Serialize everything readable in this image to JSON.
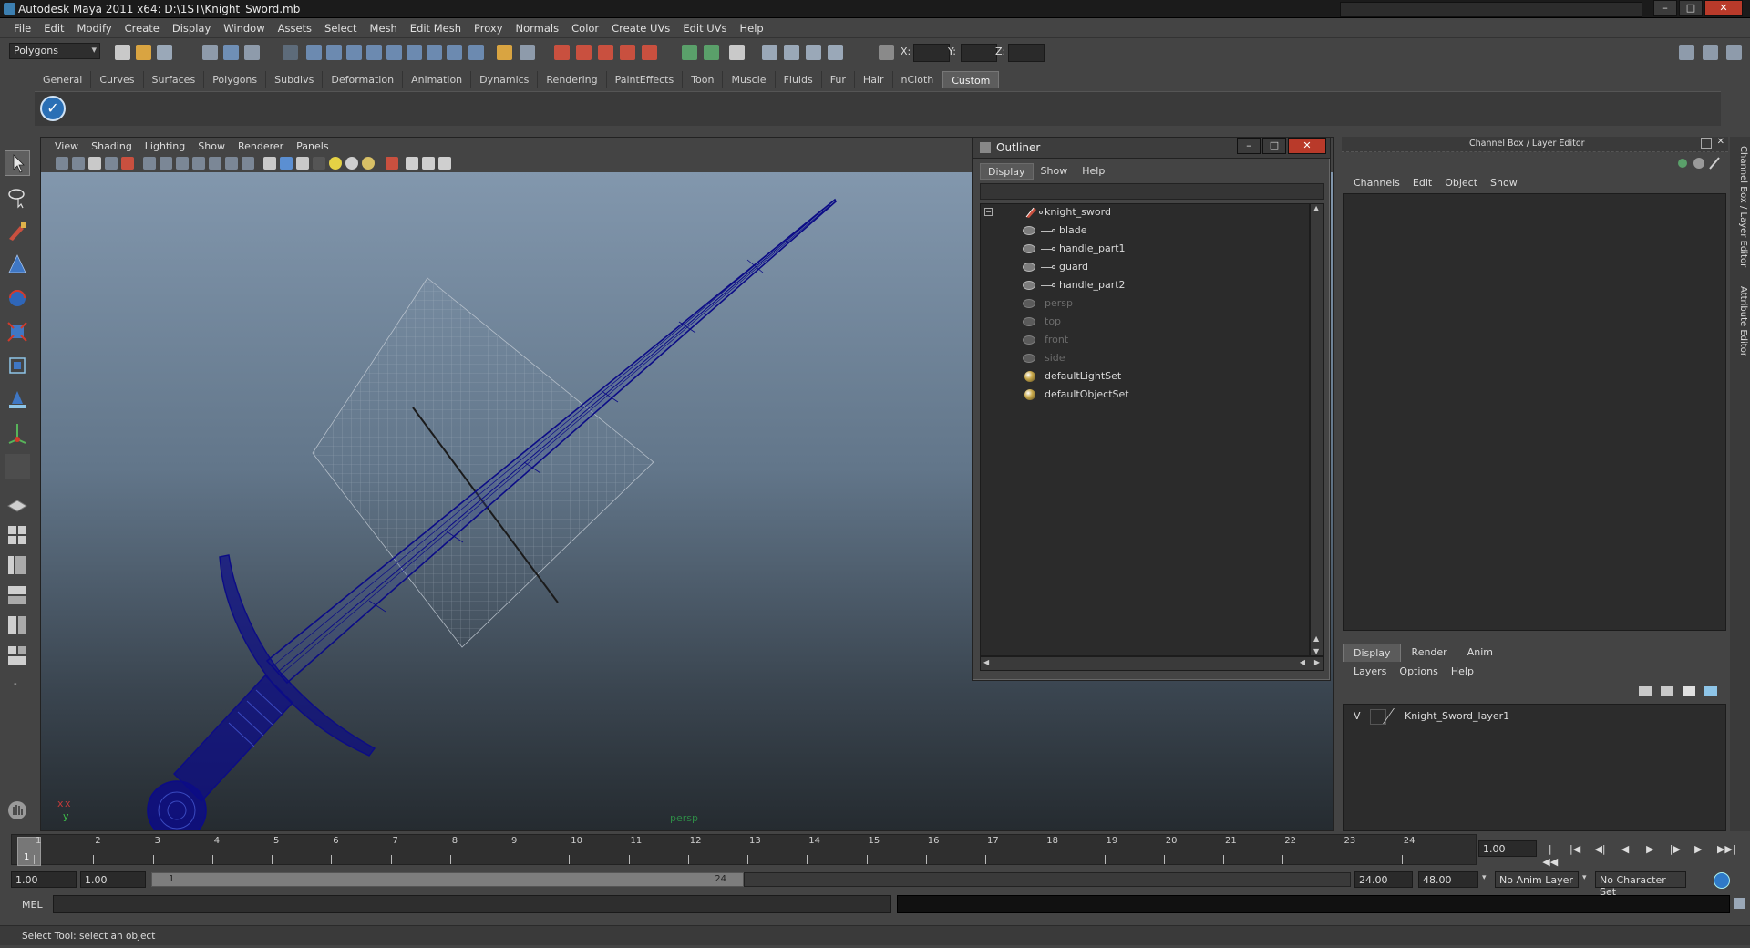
{
  "window": {
    "title": "Autodesk Maya 2011 x64: D:\\1ST\\Knight_Sword.mb",
    "buttons": [
      "–",
      "□",
      "✕"
    ]
  },
  "menubar": [
    "File",
    "Edit",
    "Modify",
    "Create",
    "Display",
    "Window",
    "Assets",
    "Select",
    "Mesh",
    "Edit Mesh",
    "Proxy",
    "Normals",
    "Color",
    "Create UVs",
    "Edit UVs",
    "Help"
  ],
  "statusline": {
    "mode": "Polygons",
    "x_label": "X:",
    "y_label": "Y:",
    "z_label": "Z:"
  },
  "shelf": {
    "tabs": [
      "General",
      "Curves",
      "Surfaces",
      "Polygons",
      "Subdivs",
      "Deformation",
      "Animation",
      "Dynamics",
      "Rendering",
      "PaintEffects",
      "Toon",
      "Muscle",
      "Fluids",
      "Fur",
      "Hair",
      "nCloth",
      "Custom"
    ],
    "active_tab": "Custom",
    "icon": "custom-shelf-check-icon"
  },
  "viewport": {
    "menu": [
      "View",
      "Shading",
      "Lighting",
      "Show",
      "Renderer",
      "Panels"
    ],
    "camera_label": "persp",
    "axis_x": "x",
    "axis_y": "y",
    "accent_color": "#0c0c86"
  },
  "outliner": {
    "title": "Outliner",
    "menu": [
      "Display",
      "Show",
      "Help"
    ],
    "items": [
      {
        "label": "knight_sword",
        "kind": "group",
        "dim": false,
        "level": 0
      },
      {
        "label": "blade",
        "kind": "mesh",
        "dim": false,
        "level": 1
      },
      {
        "label": "handle_part1",
        "kind": "mesh",
        "dim": false,
        "level": 1
      },
      {
        "label": "guard",
        "kind": "mesh",
        "dim": false,
        "level": 1
      },
      {
        "label": "handle_part2",
        "kind": "mesh",
        "dim": false,
        "level": 1
      },
      {
        "label": "persp",
        "kind": "camera",
        "dim": true,
        "level": 0
      },
      {
        "label": "top",
        "kind": "camera",
        "dim": true,
        "level": 0
      },
      {
        "label": "front",
        "kind": "camera",
        "dim": true,
        "level": 0
      },
      {
        "label": "side",
        "kind": "camera",
        "dim": true,
        "level": 0
      },
      {
        "label": "defaultLightSet",
        "kind": "set",
        "dim": false,
        "level": 0
      },
      {
        "label": "defaultObjectSet",
        "kind": "set",
        "dim": false,
        "level": 0
      }
    ]
  },
  "channelbox": {
    "header": "Channel Box / Layer Editor",
    "menu": [
      "Channels",
      "Edit",
      "Object",
      "Show"
    ],
    "layer_tabs": [
      "Display",
      "Render",
      "Anim"
    ],
    "active_layer_tab": "Display",
    "layer_menu": [
      "Layers",
      "Options",
      "Help"
    ],
    "layers": [
      {
        "visible": "V",
        "name": "Knight_Sword_layer1"
      }
    ],
    "side_tabs": [
      "Channel Box / Layer Editor",
      "Attribute Editor"
    ]
  },
  "timeline": {
    "frames": [
      "1",
      "2",
      "3",
      "4",
      "5",
      "6",
      "7",
      "8",
      "9",
      "10",
      "11",
      "12",
      "13",
      "14",
      "15",
      "16",
      "17",
      "18",
      "19",
      "20",
      "21",
      "22",
      "23",
      "24"
    ],
    "current_frame": "1",
    "current_time": "1.00"
  },
  "range": {
    "start_time": "1.00",
    "playback_start": "1.00",
    "range_start": "1",
    "range_end": "24",
    "playback_end": "24.00",
    "end_time": "48.00",
    "anim_layer": "No Anim Layer",
    "character_set": "No Character Set"
  },
  "command_line": {
    "label": "MEL"
  },
  "help_line": {
    "text": "Select Tool: select an object"
  }
}
